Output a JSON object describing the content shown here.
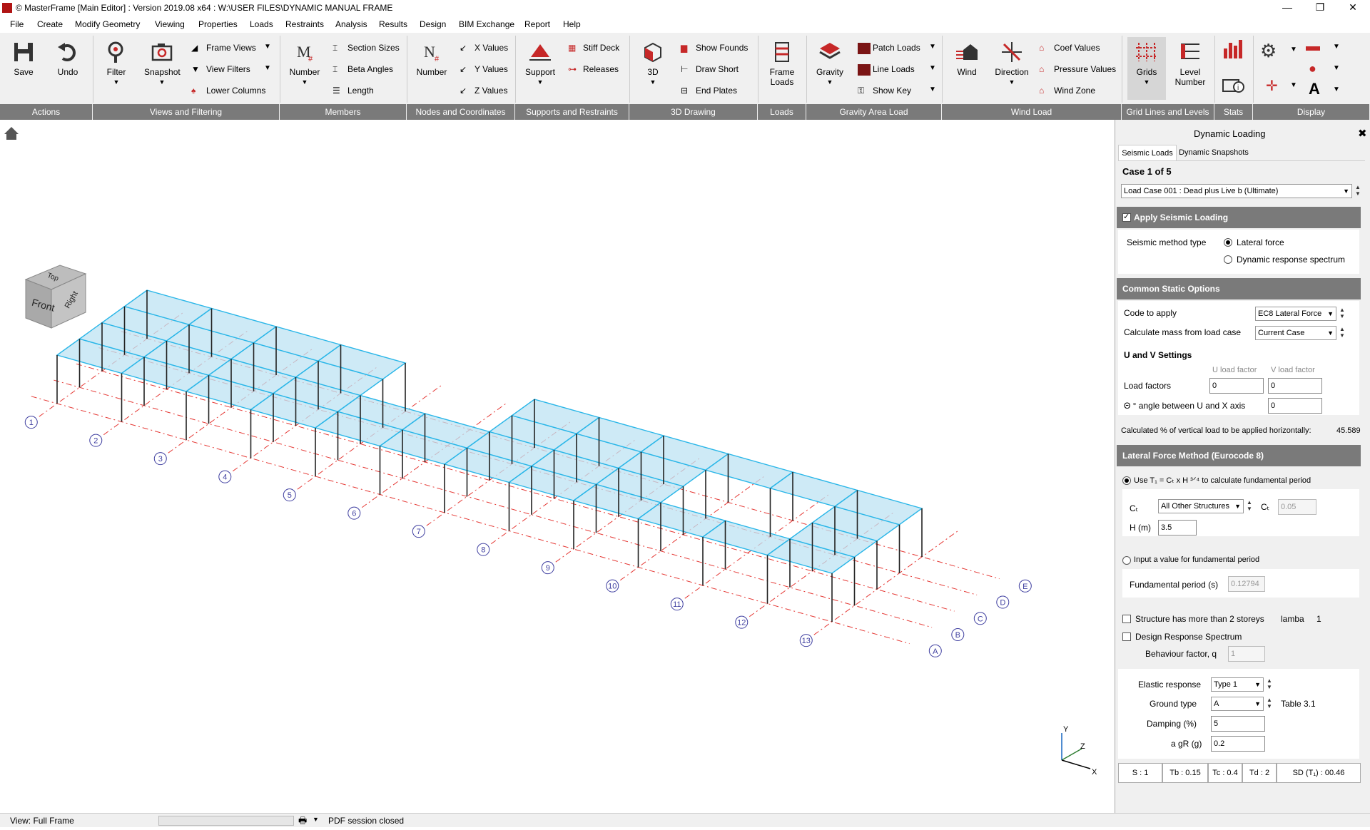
{
  "window": {
    "title": "© MasterFrame [Main Editor] : Version 2019.08 x64 : W:\\USER FILES\\DYNAMIC MANUAL FRAME",
    "minimize": "—",
    "restore": "❐",
    "close": "✕"
  },
  "menu": [
    "File",
    "Create",
    "Modify Geometry",
    "Viewing",
    "Properties",
    "Loads",
    "Restraints",
    "Analysis",
    "Results",
    "Design",
    "BIM Exchange",
    "Report",
    "Help"
  ],
  "ribbon": {
    "save": "Save",
    "undo": "Undo",
    "filter": "Filter",
    "snapshot": "Snapshot",
    "frame_views": "Frame Views",
    "view_filters": "View Filters",
    "lower_columns": "Lower Columns",
    "members_number": "Number",
    "section_sizes": "Section Sizes",
    "beta_angles": "Beta Angles",
    "length": "Length",
    "nodes_number": "Number",
    "x_values": "X Values",
    "y_values": "Y Values",
    "z_values": "Z Values",
    "support": "Support",
    "stiff_deck": "Stiff Deck",
    "releases": "Releases",
    "three_d": "3D",
    "show_founds": "Show Founds",
    "draw_short": "Draw Short",
    "end_plates": "End Plates",
    "frame_loads": "Frame Loads",
    "gravity": "Gravity",
    "patch_loads": "Patch Loads",
    "line_loads": "Line Loads",
    "show_key": "Show Key",
    "wind": "Wind",
    "direction": "Direction",
    "coef_values": "Coef Values",
    "pressure_values": "Pressure Values",
    "wind_zone": "Wind Zone",
    "grids": "Grids",
    "level_number": "Level Number",
    "groups": [
      "Actions",
      "Views and Filtering",
      "Members",
      "Nodes and Coordinates",
      "Supports and Restraints",
      "3D Drawing",
      "Loads",
      "Gravity Area Load",
      "Wind Load",
      "Grid Lines and Levels",
      "Stats",
      "Display"
    ]
  },
  "viewcube": {
    "top": "Top",
    "front": "Front",
    "right": "Right"
  },
  "grid_labels": {
    "numbers": [
      "1",
      "2",
      "3",
      "4",
      "5",
      "6",
      "7",
      "8",
      "9",
      "10",
      "11",
      "12",
      "13"
    ],
    "letters": [
      "A",
      "B",
      "C",
      "D",
      "E"
    ]
  },
  "axes": {
    "x": "X",
    "y": "Y",
    "z": "Z"
  },
  "panel": {
    "title": "Dynamic Loading",
    "close": "✖",
    "tabs": [
      "Seismic Loads",
      "Dynamic Snapshots"
    ],
    "case": "Case 1 of 5",
    "load_case": "Load Case 001 : Dead plus Live b (Ultimate)",
    "apply_seismic": "Apply Seismic Loading",
    "method_label": "Seismic method type",
    "method_lateral": "Lateral force",
    "method_dynamic": "Dynamic response spectrum",
    "common_static": "Common Static Options",
    "code_label": "Code to apply",
    "code_value": "EC8 Lateral Force",
    "mass_label": "Calculate mass from load case",
    "mass_value": "Current Case",
    "uv_settings": "U and V Settings",
    "u_header": "U load factor",
    "v_header": "V load factor",
    "load_factors": "Load factors",
    "u_value": "0",
    "v_value": "0",
    "angle_label": "Θ ° angle between U and X axis",
    "angle_value": "0",
    "calc_pct": "Calculated % of vertical load to be applied horizontally:",
    "calc_pct_value": "45.589",
    "lateral_method": "Lateral Force Method (Eurocode 8)",
    "use_t1": "Use T₁ = Cₜ x H ³ᐟ⁴ to calculate fundamental period",
    "ct_label": "Cₜ",
    "ct_value": "All Other Structures",
    "ct2_label": "Cₜ",
    "ct2_value": "0.05",
    "h_label": "H (m)",
    "h_value": "3.5",
    "input_period": "Input a value for fundamental period",
    "fund_period": "Fundamental period (s)",
    "fund_period_value": "0.12794",
    "more_storeys": "Structure has more than 2 storeys",
    "lamba": "lamba",
    "lamba_value": "1",
    "design_spectrum": "Design Response Spectrum",
    "behaviour": "Behaviour factor, q",
    "behaviour_value": "1",
    "elastic_label": "Elastic response",
    "elastic_value": "Type 1",
    "ground_label": "Ground type",
    "ground_value": "A",
    "table_ref": "Table 3.1",
    "damping_label": "Damping (%)",
    "damping_value": "5",
    "agr_label": "a gR (g)",
    "agr_value": "0.2",
    "stats": [
      "S : 1",
      "Tb : 0.15",
      "Tc : 0.4",
      "Td : 2",
      "SD (T₁) : 00.46"
    ]
  },
  "status": {
    "view": "View: Full Frame",
    "pdf": "PDF session closed"
  },
  "colors": {
    "accent_red": "#c62828",
    "frame_blue": "#29b6e8",
    "panel_fill": "#bde3f3",
    "grid_red": "#e53935",
    "label_blue": "#3f3fa0"
  }
}
